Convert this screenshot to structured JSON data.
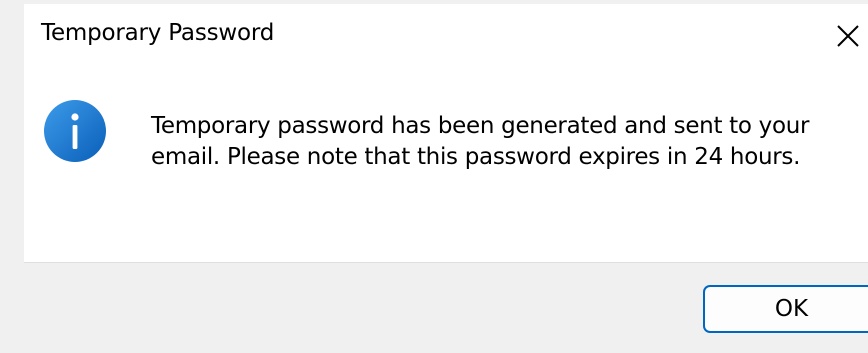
{
  "dialog": {
    "title": "Temporary Password",
    "message": "Temporary password has been generated and sent to your email. Please note that this password expires in 24 hours.",
    "icon": "info-icon",
    "ok_label": "OK"
  },
  "colors": {
    "icon_blue": "#0d6fd0",
    "button_border": "#0067c0",
    "panel": "#ffffff",
    "footer": "#f0f0f0"
  }
}
